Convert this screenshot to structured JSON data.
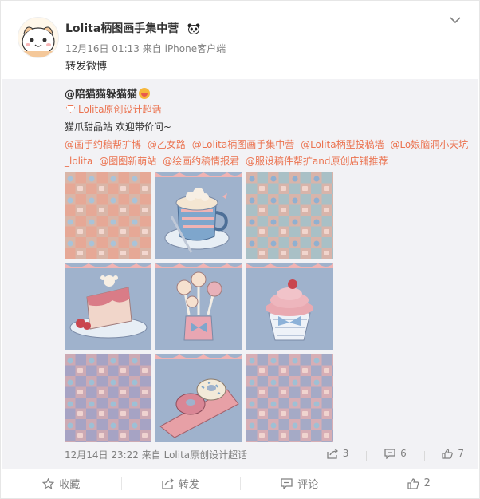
{
  "post": {
    "username": "Lolita柄图画手集中营",
    "time": "12月16日 01:13",
    "source_prefix": "来自",
    "source": "iPhone客户端",
    "text": "转发微博"
  },
  "repost": {
    "username": "@陪猫猫躲猫猫",
    "super_topic": "Lolita原创设计超话",
    "description": "猫爪甜品站 欢迎带价问~",
    "mentions": [
      "@画手约稿帮扩博",
      "@乙女路",
      "@Lolita柄图画手集中营",
      "@Lolita柄型投稿墙",
      "@Lo娘脑洞小天坑_lolita",
      "@图图新萌站",
      "@绘画约稿情报君",
      "@服设稿件帮扩and原创店铺推荐"
    ],
    "time": "12月14日 23:22",
    "source_prefix": "来自",
    "source": "Lolita原创设计超话",
    "repost_count": "3",
    "comment_count": "6",
    "like_count": "7"
  },
  "actions": {
    "favorite": "收藏",
    "forward": "转发",
    "comment": "评论",
    "like": "2"
  },
  "colors": {
    "accent": "#eb7350",
    "meta_gray": "#808080",
    "repost_bg": "#f2f2f5"
  }
}
